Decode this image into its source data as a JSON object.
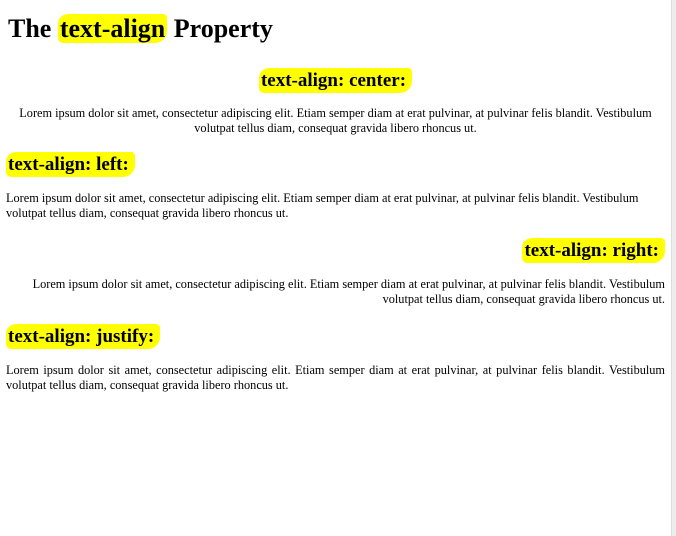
{
  "heading": {
    "before": "The ",
    "highlight": "text-align",
    "after": " Property"
  },
  "sections": [
    {
      "label": "text-align: center:",
      "text": "Lorem ipsum dolor sit amet, consectetur adipiscing elit. Etiam semper diam at erat pulvinar, at pulvinar felis blandit. Vestibulum volutpat tellus diam, consequat gravida libero rhoncus ut."
    },
    {
      "label": "text-align: left:",
      "text": "Lorem ipsum dolor sit amet, consectetur adipiscing elit. Etiam semper diam at erat pulvinar, at pulvinar felis blandit. Vestibulum volutpat tellus diam, consequat gravida libero rhoncus ut."
    },
    {
      "label": "text-align: right:",
      "text": "Lorem ipsum dolor sit amet, consectetur adipiscing elit. Etiam semper diam at erat pulvinar, at pulvinar felis blandit. Vestibulum volutpat tellus diam, consequat gravida libero rhoncus ut."
    },
    {
      "label": "text-align: justify:",
      "text": "Lorem ipsum dolor sit amet, consectetur adipiscing elit. Etiam semper diam at erat pulvinar, at pulvinar felis blandit. Vestibulum volutpat tellus diam, consequat gravida libero rhoncus ut."
    }
  ],
  "colors": {
    "highlight": "#ffff00",
    "text": "#000000",
    "background": "#ffffff"
  }
}
